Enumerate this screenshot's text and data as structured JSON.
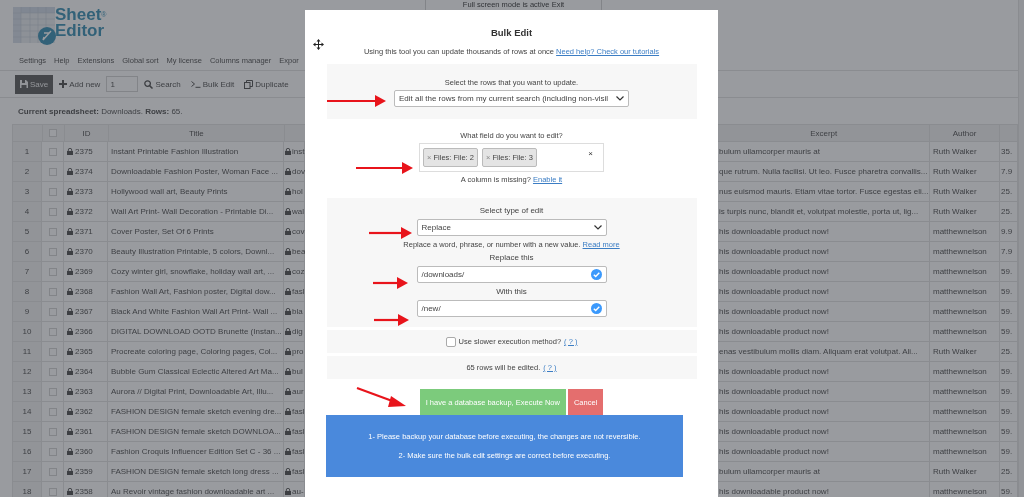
{
  "logo": {
    "line_1": "Sheet",
    "mark": "®",
    "line_2": "Editor"
  },
  "fullscreen_notice": "Full screen mode is active Exit",
  "menu": [
    "Settings",
    "Help",
    "Extensions",
    "Global sort",
    "My license",
    "Columns manager",
    "Expor"
  ],
  "toolbar": [
    {
      "kind": "save",
      "label": "Save"
    },
    {
      "kind": "add",
      "label": "Add new"
    },
    {
      "kind": "field",
      "value": "1"
    },
    {
      "kind": "search",
      "label": "Search"
    },
    {
      "kind": "terminal",
      "label": "Bulk Edit"
    },
    {
      "kind": "copy",
      "label": "Duplicate"
    }
  ],
  "status": "**Current spreadsheet:** Downloads. **Rows:** 65.",
  "table": {
    "header": {
      "checked": false,
      "id": "ID",
      "title": "Title",
      "excerpt": "Excerpt",
      "author": "Author"
    },
    "rows": [
      {
        "number": "1",
        "checked": false,
        "id": "2375",
        "title": "Instant Printable Fashion Illustration",
        "column_5": "inst",
        "excerpt": "bulum ullamcorper mauris at",
        "author": "Ruth Walker",
        "column_8": "35."
      },
      {
        "number": "2",
        "checked": false,
        "id": "2374",
        "title": "Downloadable Fashion Poster, Woman Face ...",
        "column_5": "dov",
        "excerpt": "que rutrum. Nulla facilisi. Ut leo. Fusce pharetra convallis...",
        "author": "Ruth Walker",
        "column_8": "7.9"
      },
      {
        "number": "3",
        "checked": false,
        "id": "2373",
        "title": "Hollywood wall art, Beauty Prints",
        "column_5": "hol",
        "excerpt": "nus euismod mauris. Etiam vitae tortor. Fusce egestas eli...",
        "author": "Ruth Walker",
        "column_8": "25."
      },
      {
        "number": "4",
        "checked": false,
        "id": "2372",
        "title": "Wall Art Print- Wall Decoration - Printable Di...",
        "column_5": "wal",
        "excerpt": "is turpis nunc, blandit et, volutpat molestie, porta ut, lig...",
        "author": "Ruth Walker",
        "column_8": "25."
      },
      {
        "number": "5",
        "checked": false,
        "id": "2371",
        "title": "Cover Poster, Set Of 6 Prints",
        "column_5": "cov",
        "excerpt": "his downloadable product now!",
        "author": "matthewnelson",
        "column_8": "9.9"
      },
      {
        "number": "6",
        "checked": false,
        "id": "2370",
        "title": "Beauty Illustration Printable, 5 colors, Downl...",
        "column_5": "bea",
        "excerpt": "his downloadable product now!",
        "author": "matthewnelson",
        "column_8": "7.9"
      },
      {
        "number": "7",
        "checked": false,
        "id": "2369",
        "title": "Cozy winter girl, snowflake, holiday wall art, ...",
        "column_5": "coz",
        "excerpt": "his downloadable product now!",
        "author": "matthewnelson",
        "column_8": "59."
      },
      {
        "number": "8",
        "checked": false,
        "id": "2368",
        "title": "Fashion Wall Art, Fashion poster, Digital dow...",
        "column_5": "fasl",
        "excerpt": "his downloadable product now!",
        "author": "matthewnelson",
        "column_8": "59."
      },
      {
        "number": "9",
        "checked": false,
        "id": "2367",
        "title": "Black And White Fashion Wall Art Print- Wall ...",
        "column_5": "bla",
        "excerpt": "his downloadable product now!",
        "author": "matthewnelson",
        "column_8": "59."
      },
      {
        "number": "10",
        "checked": false,
        "id": "2366",
        "title": "DIGITAL DOWNLOAD OOTD Brunette (Instan...",
        "column_5": "dig",
        "excerpt": "his downloadable product now!",
        "author": "matthewnelson",
        "column_8": "59."
      },
      {
        "number": "11",
        "checked": false,
        "id": "2365",
        "title": "Procreate coloring page, Coloring pages, Col...",
        "column_5": "pro",
        "excerpt": "enas vestibulum mollis diam. Aliquam erat volutpat. Ali...",
        "author": "Ruth Walker",
        "column_8": "25."
      },
      {
        "number": "12",
        "checked": false,
        "id": "2364",
        "title": "Bubble Gum Classical Eclectic Altered Art Ma...",
        "column_5": "bul",
        "excerpt": "his downloadable product now!",
        "author": "matthewnelson",
        "column_8": "59."
      },
      {
        "number": "13",
        "checked": false,
        "id": "2363",
        "title": "Aurora // Digital Print, Downloadable Art, Illu...",
        "column_5": "aur",
        "excerpt": "his downloadable product now!",
        "author": "matthewnelson",
        "column_8": "59."
      },
      {
        "number": "14",
        "checked": false,
        "id": "2362",
        "title": "FASHION DESIGN female sketch evening dre...",
        "column_5": "fasl",
        "excerpt": "his downloadable product now!",
        "author": "matthewnelson",
        "column_8": "59."
      },
      {
        "number": "15",
        "checked": false,
        "id": "2361",
        "title": "FASHION DESIGN female sketch DOWNLOA...",
        "column_5": "fasl",
        "excerpt": "his downloadable product now!",
        "author": "matthewnelson",
        "column_8": "59."
      },
      {
        "number": "16",
        "checked": false,
        "id": "2360",
        "title": "Fashion Croquis Influencer Edition Set C - 36 ...",
        "column_5": "fasl",
        "excerpt": "his downloadable product now!",
        "author": "matthewnelson",
        "column_8": "59."
      },
      {
        "number": "17",
        "checked": false,
        "id": "2359",
        "title": "FASHION DESIGN female sketch long dress ...",
        "column_5": "fasl",
        "excerpt": "bulum ullamcorper mauris at",
        "author": "Ruth Walker",
        "column_8": "25."
      },
      {
        "number": "18",
        "checked": false,
        "id": "2358",
        "title": "Au Revoir vintage fashion downloadable art ...",
        "column_5": "au-",
        "excerpt": "his downloadable product now!",
        "author": "matthewnelson",
        "column_8": "59."
      }
    ]
  },
  "modal": {
    "title": "Bulk Edit",
    "intro": "Using this tool you can update thousands of rows at once",
    "intro_link": "Need help? Check our tutorials",
    "rows_label": "Select the rows that you want to update.",
    "rows_select": "Edit all the rows from my current search (including non-visil",
    "field_label": "What field do you want to edit?",
    "field_tags": [
      "Files: File: 2",
      "Files: File: 3"
    ],
    "tag_remove": "×",
    "clear": "×",
    "missing": "A column is missing?",
    "missing_link": "Enable it",
    "type_label": "Select type of edit",
    "type_select": "Replace",
    "type_help": "Replace a word, phrase, or number with a new value.",
    "type_help_link": "Read more",
    "replace_label": "Replace this",
    "replace_value": "/downloads/",
    "with_label": "With this",
    "with_value": "/new/",
    "slower": {
      "label": "Use slower execution method?",
      "checked": false,
      "help": "( ? )"
    },
    "count": "65 rows will be edited.",
    "count_help": "( ? )",
    "execute": "I have a database backup, Execute Now",
    "cancel": "Cancel",
    "notes": [
      "1- Please backup your database before executing, the changes are not reversible.",
      "2- Make sure the bulk edit settings are correct before executing."
    ]
  }
}
